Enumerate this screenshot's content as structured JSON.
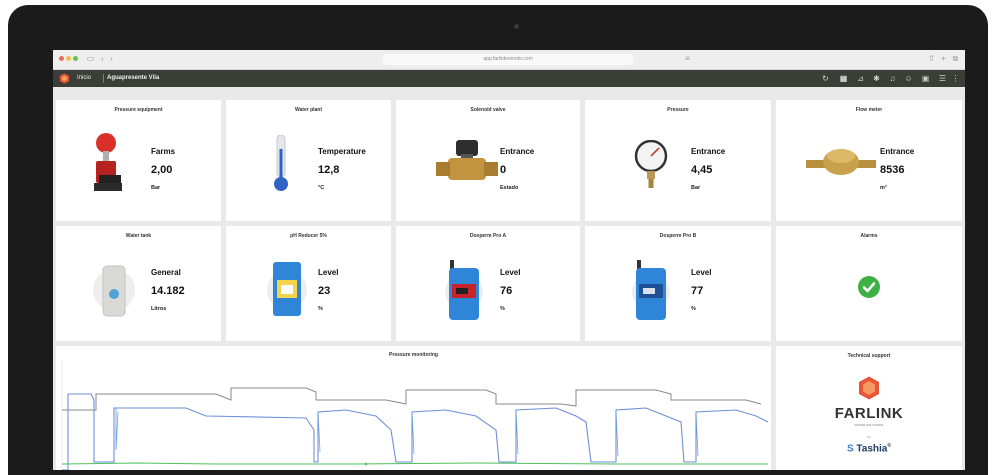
{
  "browser": {
    "url": "app.farlinkremote.com"
  },
  "app": {
    "nav_home": "Inicio",
    "nav_site": "Aguapresente Vila"
  },
  "cards": [
    {
      "title": "Pressure equipment",
      "label": "Farms",
      "value": "2,00",
      "unit": "Bar",
      "icon": "pressure-pump-icon"
    },
    {
      "title": "Water plant",
      "label": "Temperature",
      "value": "12,8",
      "unit": "°C",
      "icon": "thermometer-icon"
    },
    {
      "title": "Solenoid valve",
      "label": "Entrance",
      "value": "0",
      "unit": "Estado",
      "icon": "solenoid-valve-icon"
    },
    {
      "title": "Pressure",
      "label": "Entrance",
      "value": "4,45",
      "unit": "Bar",
      "icon": "manometer-icon"
    },
    {
      "title": "Flow meter",
      "label": "Entrance",
      "value": "8536",
      "unit": "m³",
      "icon": "water-meter-icon"
    },
    {
      "title": "Water tank",
      "label": "General",
      "value": "14.182",
      "unit": "Litros",
      "icon": "water-tank-icon"
    },
    {
      "title": "pH Reducer 5%",
      "label": "Level",
      "value": "23",
      "unit": "%",
      "icon": "chemical-drum-icon"
    },
    {
      "title": "Dosperm Pro A",
      "label": "Level",
      "value": "76",
      "unit": "%",
      "icon": "dosing-pump-icon"
    },
    {
      "title": "Dosperm Pro B",
      "label": "Level",
      "value": "77",
      "unit": "%",
      "icon": "dosing-pump-icon"
    },
    {
      "title": "Alarms",
      "label": "",
      "value": "",
      "unit": "",
      "icon": "check-circle-icon"
    }
  ],
  "monitoring": {
    "title": "Pressure monitoring",
    "colors": {
      "series_a": "#6f8fd8",
      "series_b": "#6b9fe0",
      "series_c": "#8a8a8a",
      "series_d": "#4ec25b"
    }
  },
  "support": {
    "title": "Technical support",
    "farlink": "FARLINK",
    "farlink_sub": "WATER SOLUTIONS",
    "by": "by",
    "tashia": "Tashia",
    "tashia_mark": "®"
  },
  "colors": {
    "app_bar": "#3b3e36",
    "card_bg": "#ffffff",
    "screen_bg": "#e9e9e9",
    "bezel": "#1b1b1c",
    "alarm_ok": "#3fb043"
  }
}
